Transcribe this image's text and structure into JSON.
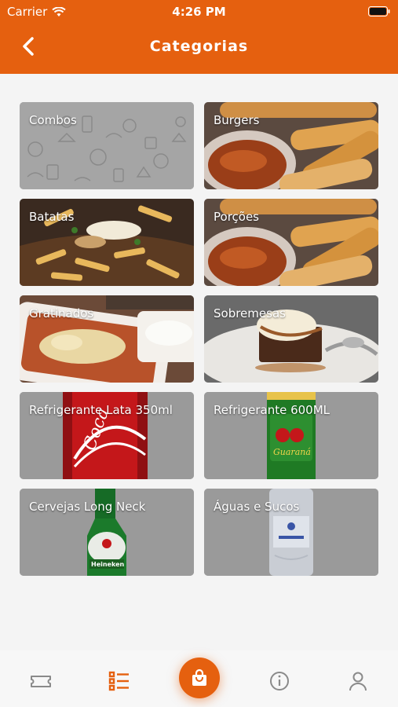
{
  "status_bar": {
    "carrier": "Carrier",
    "time": "4:26 PM"
  },
  "header": {
    "title": "Categorias"
  },
  "categories": [
    {
      "label": "Combos"
    },
    {
      "label": "Burgers"
    },
    {
      "label": "Batatas"
    },
    {
      "label": "Porções"
    },
    {
      "label": "Gratinados"
    },
    {
      "label": "Sobremesas"
    },
    {
      "label": "Refrigerante Lata 350ml"
    },
    {
      "label": "Refrigerante 600ML"
    },
    {
      "label": "Cervejas Long Neck"
    },
    {
      "label": "Águas e Sucos"
    }
  ],
  "colors": {
    "accent": "#e5600f",
    "inactive_icon": "#8a8a8a"
  },
  "tabbar": {
    "items": [
      {
        "icon": "ticket-icon"
      },
      {
        "icon": "list-icon"
      },
      {
        "icon": "shopping-bag-icon"
      },
      {
        "icon": "info-icon"
      },
      {
        "icon": "user-icon"
      }
    ]
  }
}
